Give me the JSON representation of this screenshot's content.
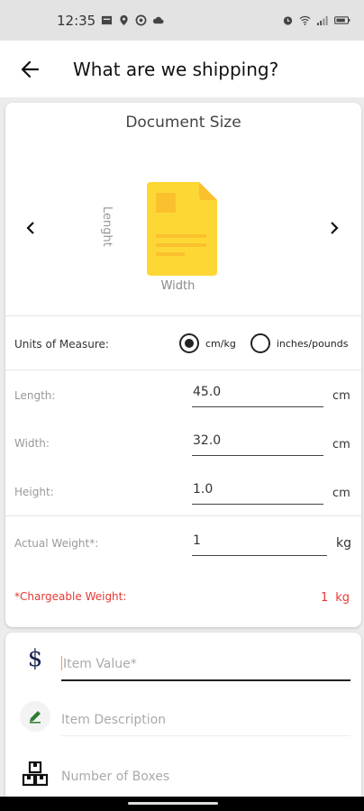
{
  "status_bar": {
    "time": "12:35"
  },
  "app_bar": {
    "title": "What are we shipping?"
  },
  "document": {
    "title": "Document Size",
    "length_label": "Lenght",
    "width_label": "Width",
    "doc_color": "#fdd835",
    "doc_accent": "#fbc02d"
  },
  "units": {
    "label": "Units of Measure:",
    "options": [
      "cm/kg",
      "inches/pounds"
    ],
    "selected": "cm/kg"
  },
  "dimensions": [
    {
      "label": "Length:",
      "value": "45.0",
      "unit": "cm"
    },
    {
      "label": "Width:",
      "value": "32.0",
      "unit": "cm"
    },
    {
      "label": "Height:",
      "value": "1.0",
      "unit": "cm"
    }
  ],
  "weight": {
    "label": "Actual Weight*:",
    "value": "1",
    "unit": "kg"
  },
  "chargeable": {
    "label": "*Chargeable Weight:",
    "value": "1",
    "unit": "kg",
    "color": "#e53935"
  },
  "item_fields": [
    {
      "icon": "dollar-icon",
      "placeholder": "Item Value*"
    },
    {
      "icon": "pencil-icon",
      "placeholder": "Item Description"
    },
    {
      "icon": "boxes-icon",
      "placeholder": "Number of Boxes"
    }
  ]
}
